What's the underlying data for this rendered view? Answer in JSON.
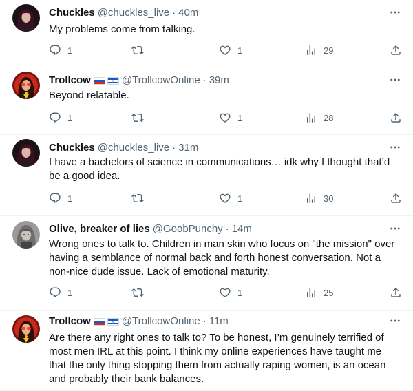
{
  "tweets": [
    {
      "name": "Chuckles",
      "handle": "@chuckles_live",
      "dot": "·",
      "time": "40m",
      "text": "My problems come from talking.",
      "replies": "1",
      "retweets": "",
      "likes": "1",
      "views": "29",
      "avatar": "dark-haired-woman-avatar",
      "flags": []
    },
    {
      "name": "Trollcow",
      "handle": "@TrollcowOnline",
      "dot": "·",
      "time": "39m",
      "text": "Beyond relatable.",
      "replies": "1",
      "retweets": "",
      "likes": "1",
      "views": "28",
      "avatar": "red-sunglasses-woman-avatar",
      "flags": [
        "russia-flag",
        "israel-flag"
      ]
    },
    {
      "name": "Chuckles",
      "handle": "@chuckles_live",
      "dot": "·",
      "time": "31m",
      "text": "I have a bachelors of science in communications… idk why I thought that’d be a good idea.",
      "replies": "1",
      "retweets": "",
      "likes": "1",
      "views": "30",
      "avatar": "dark-haired-woman-avatar",
      "flags": []
    },
    {
      "name": "Olive, breaker of lies",
      "handle": "@GoobPunchy",
      "dot": "·",
      "time": "14m",
      "text": "Wrong ones to talk to. Children in man skin who focus on \"the mission\" over having a semblance of normal back and forth honest conversation. Not a non-nice dude issue. Lack of emotional maturity.",
      "replies": "1",
      "retweets": "",
      "likes": "1",
      "views": "25",
      "avatar": "grey-haired-woman-avatar",
      "flags": []
    },
    {
      "name": "Trollcow",
      "handle": "@TrollcowOnline",
      "dot": "·",
      "time": "11m",
      "text": "Are there any right ones to talk to? To be honest, I’m genuinely terrified of most men IRL at this point. I think my online experiences have taught me that the only thing stopping them from actually raping women, is an ocean and probably their bank balances.",
      "replies": "",
      "retweets": "",
      "likes": "",
      "views": "",
      "avatar": "red-sunglasses-woman-avatar",
      "flags": [
        "russia-flag",
        "israel-flag"
      ]
    }
  ],
  "colors": {
    "text": "#0f1419",
    "muted": "#536471",
    "divider": "#eff3f4"
  }
}
